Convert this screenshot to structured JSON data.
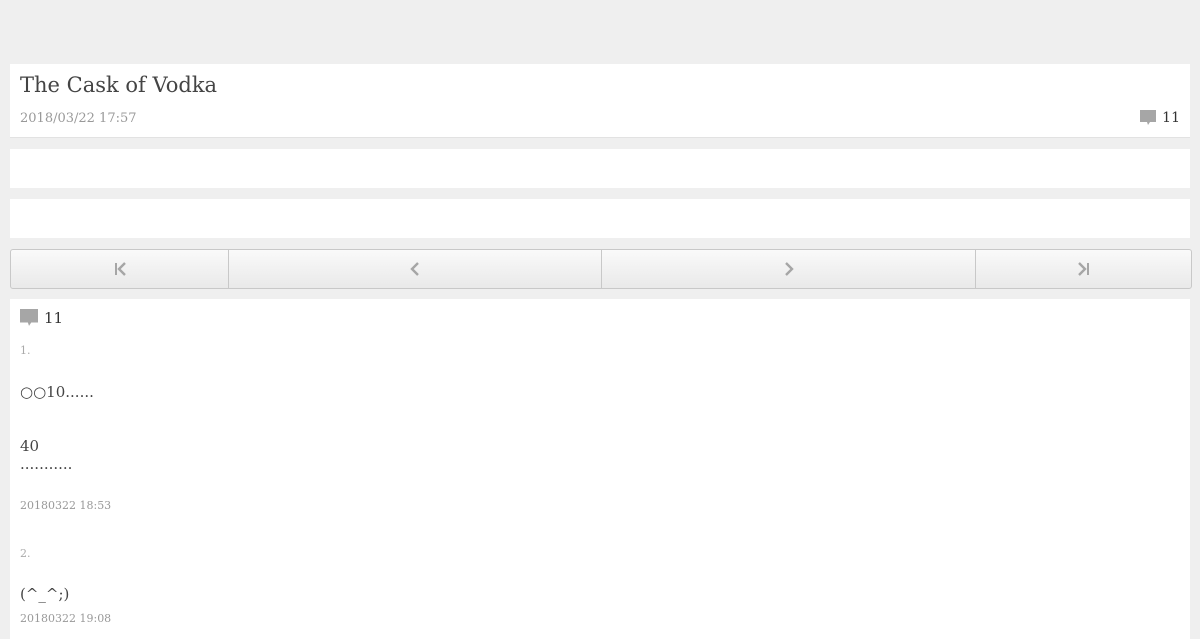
{
  "entry": {
    "title": "The Cask of Vodka",
    "date": "2018/03/22 17:57",
    "comment_count": "11"
  },
  "icons": {
    "comment": "speech-bubble-icon",
    "first": "first-page-icon",
    "prev": "chevron-left-icon",
    "next": "chevron-right-icon",
    "last": "last-page-icon"
  },
  "colors": {
    "background": "#efefef",
    "panel": "#ffffff",
    "icon_gray": "#a6a6a6",
    "text": "#444444",
    "muted": "#999999"
  },
  "comments": {
    "count": "11",
    "items": [
      {
        "number": "1.",
        "lines": [
          "○○10......",
          "40",
          "..........."
        ],
        "date": "20180322 18:53"
      },
      {
        "number": "2.",
        "lines": [
          "(^_^;)"
        ],
        "date": "20180322 19:08"
      }
    ]
  }
}
